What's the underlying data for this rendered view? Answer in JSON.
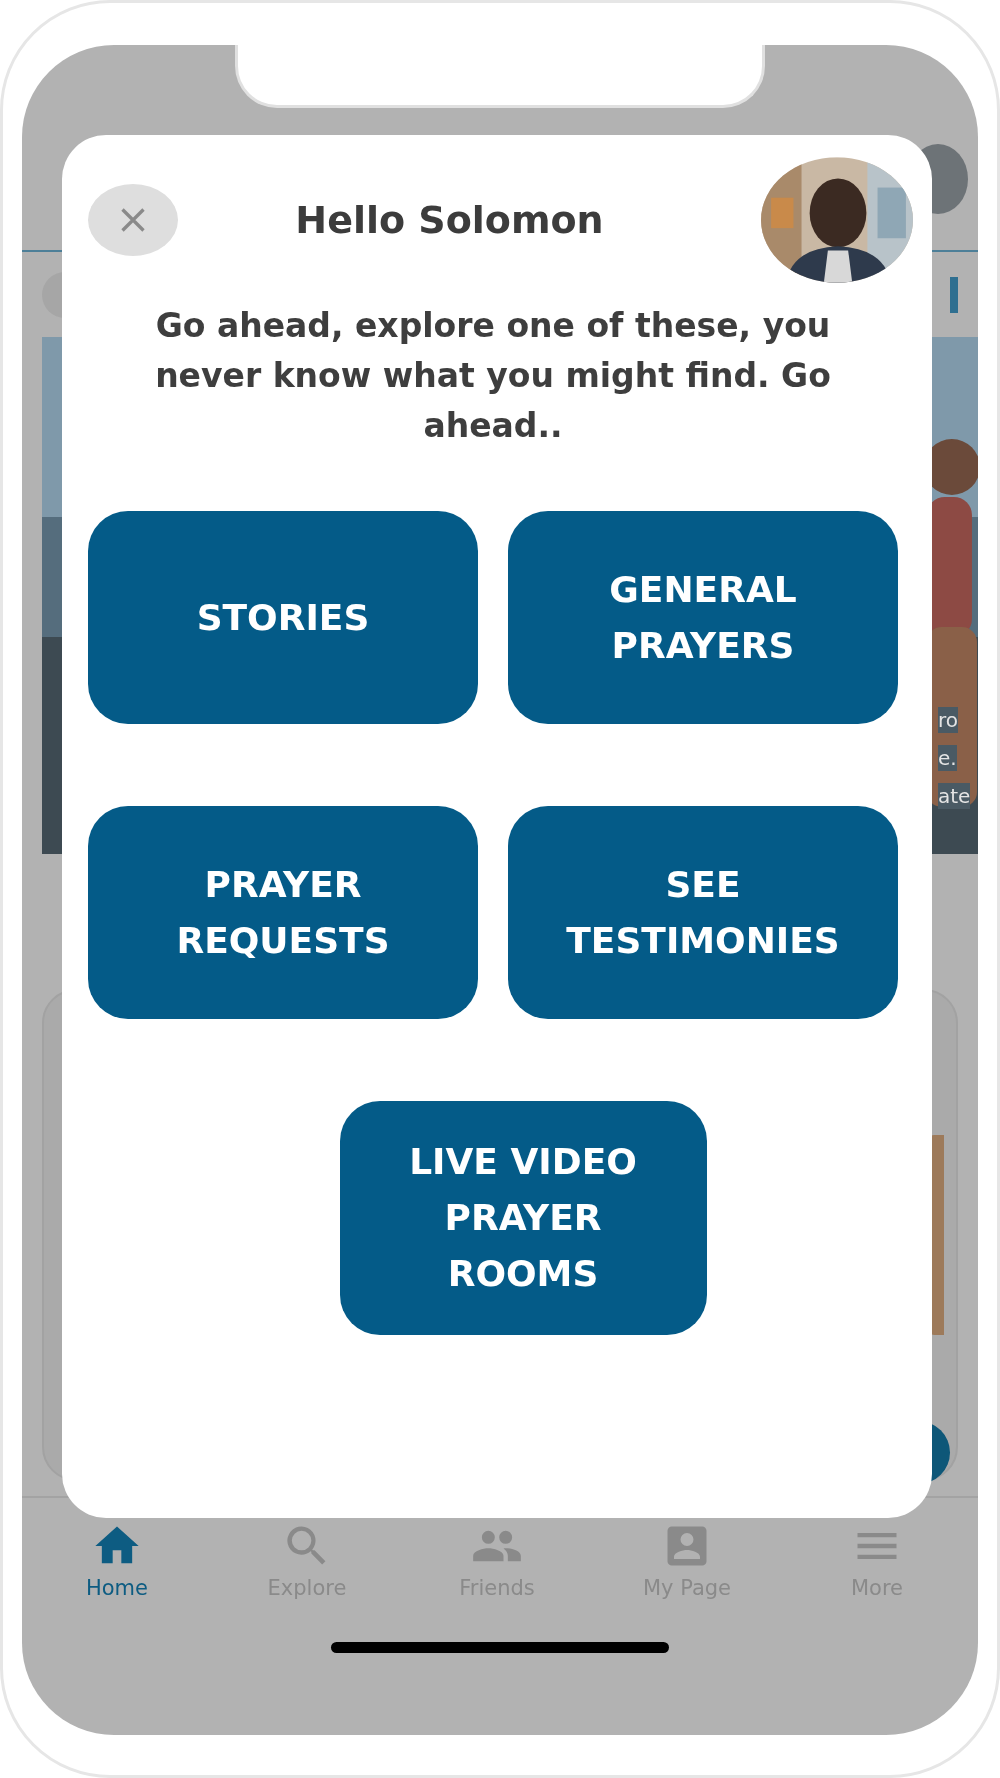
{
  "background": {
    "feature_card": {
      "kind": "picture",
      "text_fragments": [
        "ro",
        "e.",
        "ate"
      ]
    }
  },
  "modal": {
    "title": "Hello Solomon",
    "message": "Go ahead, explore one of these, you never know what you might find. Go ahead..",
    "options": [
      {
        "label": "STORIES"
      },
      {
        "label": "GENERAL PRAYERS"
      },
      {
        "label": "PRAYER REQUESTS"
      },
      {
        "label": "SEE TESTIMONIES"
      },
      {
        "label": "LIVE VIDEO PRAYER ROOMS"
      }
    ]
  },
  "nav": [
    {
      "label": "Home",
      "selected": true
    },
    {
      "label": "Explore",
      "selected": false
    },
    {
      "label": "Friends",
      "selected": false
    },
    {
      "label": "My Page",
      "selected": false
    },
    {
      "label": "More",
      "selected": false
    }
  ]
}
